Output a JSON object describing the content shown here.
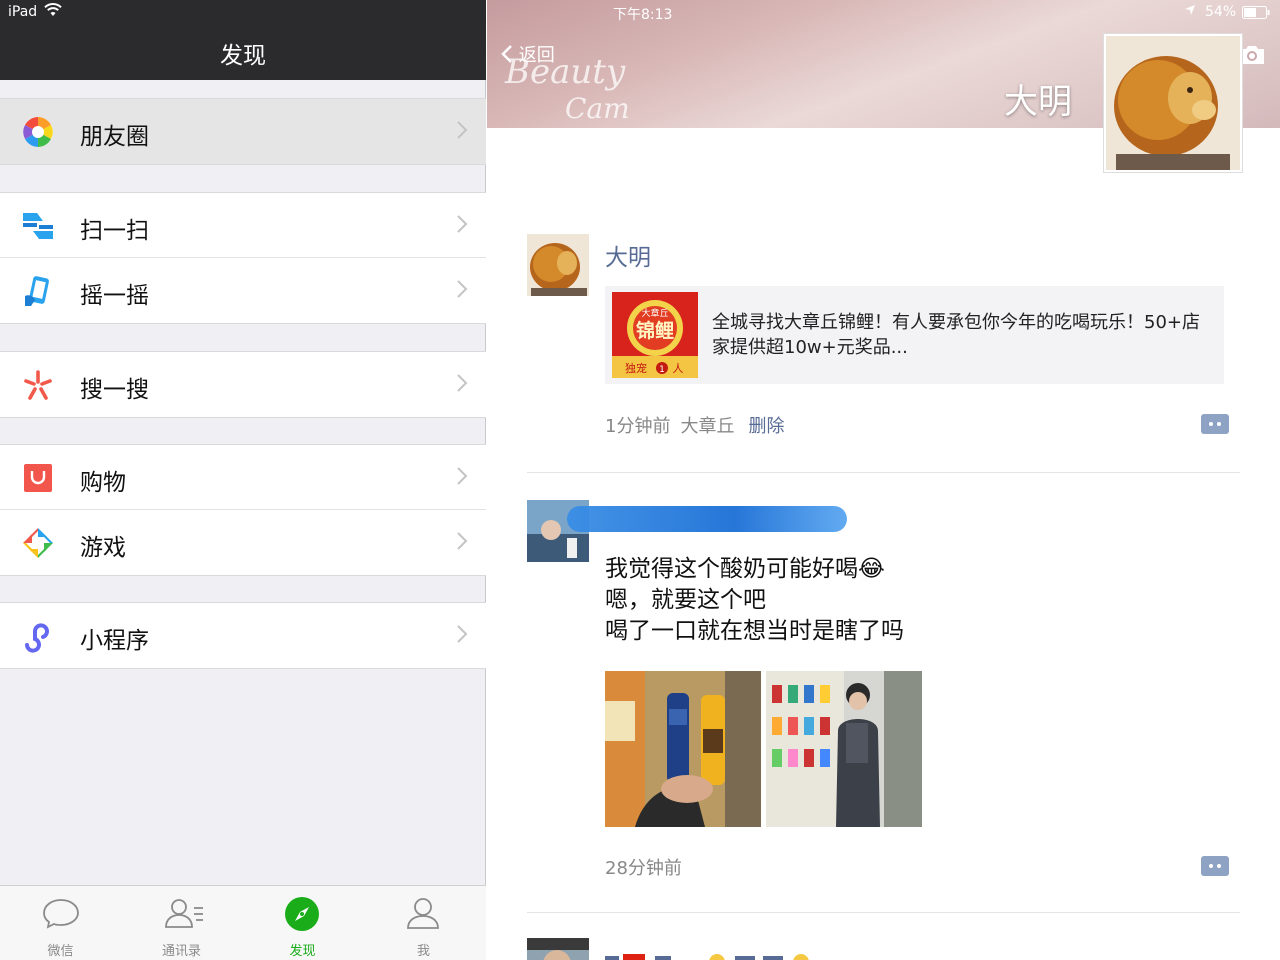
{
  "status": {
    "carrier": "iPad",
    "time": "下午8:13",
    "battery": "54%"
  },
  "left": {
    "title": "发现",
    "menu": [
      {
        "label": "朋友圈",
        "icon": "moments-icon"
      },
      {
        "label": "扫一扫",
        "icon": "scan-icon"
      },
      {
        "label": "摇一摇",
        "icon": "shake-icon"
      },
      {
        "label": "搜一搜",
        "icon": "search-icon"
      },
      {
        "label": "购物",
        "icon": "shopping-icon"
      },
      {
        "label": "游戏",
        "icon": "games-icon"
      },
      {
        "label": "小程序",
        "icon": "mini-program-icon"
      }
    ],
    "tabs": [
      {
        "label": "微信",
        "icon": "chat-icon"
      },
      {
        "label": "通讯录",
        "icon": "contacts-icon"
      },
      {
        "label": "发现",
        "icon": "compass-icon"
      },
      {
        "label": "我",
        "icon": "profile-icon"
      }
    ],
    "active_tab": "发现"
  },
  "right": {
    "back_label": "返回",
    "cover_overlay": [
      "Beauty",
      "Cam"
    ],
    "profile_name": "大明",
    "posts": [
      {
        "author": "大明",
        "link_thumb_text": [
          "大章丘",
          "锦鲤",
          "独宠",
          "1",
          "人"
        ],
        "link_text": "全城寻找大章丘锦鲤！有人要承包你今年的吃喝玩乐！50+店家提供超10w+元奖品...",
        "time": "1分钟前",
        "location": "大章丘",
        "delete_label": "删除"
      },
      {
        "lines": [
          "我觉得这个酸奶可能好喝😂",
          "嗯，就要这个吧",
          "喝了一口就在想当时是瞎了吗"
        ],
        "time": "28分钟前"
      }
    ]
  },
  "colors": {
    "accent": "#1aad19",
    "link": "#576b95",
    "navbar": "#2b2b2e"
  }
}
